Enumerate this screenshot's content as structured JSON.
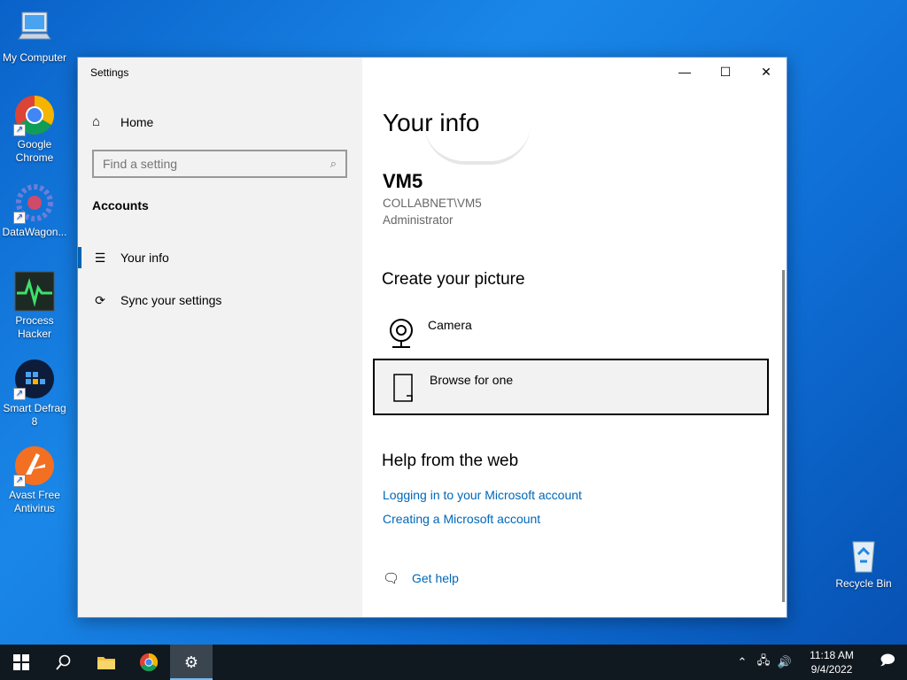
{
  "desktop": {
    "icons": [
      {
        "label": "My Computer"
      },
      {
        "label": "Google Chrome"
      },
      {
        "label": "DataWagon..."
      },
      {
        "label": "Process Hacker"
      },
      {
        "label": "Smart Defrag 8"
      },
      {
        "label": "Avast Free Antivirus"
      },
      {
        "label": "Recycle Bin"
      }
    ]
  },
  "window": {
    "title": "Settings",
    "controls": {
      "minimize": "—",
      "maximize": "☐",
      "close": "✕"
    }
  },
  "sidebar": {
    "home_label": "Home",
    "search_placeholder": "Find a setting",
    "section_label": "Accounts",
    "items": [
      {
        "label": "Your info",
        "icon": "person-list-icon",
        "active": true
      },
      {
        "label": "Sync your settings",
        "icon": "sync-icon",
        "active": false
      }
    ]
  },
  "main": {
    "page_title": "Your info",
    "user": {
      "name": "VM5",
      "account": "COLLABNET\\VM5",
      "role": "Administrator"
    },
    "create_picture": {
      "heading": "Create your picture",
      "camera_label": "Camera",
      "browse_label": "Browse for one"
    },
    "help": {
      "heading": "Help from the web",
      "links": [
        "Logging in to your Microsoft account",
        "Creating a Microsoft account"
      ],
      "get_help": "Get help"
    }
  },
  "taskbar": {
    "time": "11:18 AM",
    "date": "9/4/2022"
  },
  "colors": {
    "accent": "#0063b1",
    "link": "#0067b8",
    "taskbar": "#101820",
    "desktop": "#0f6fd6"
  }
}
